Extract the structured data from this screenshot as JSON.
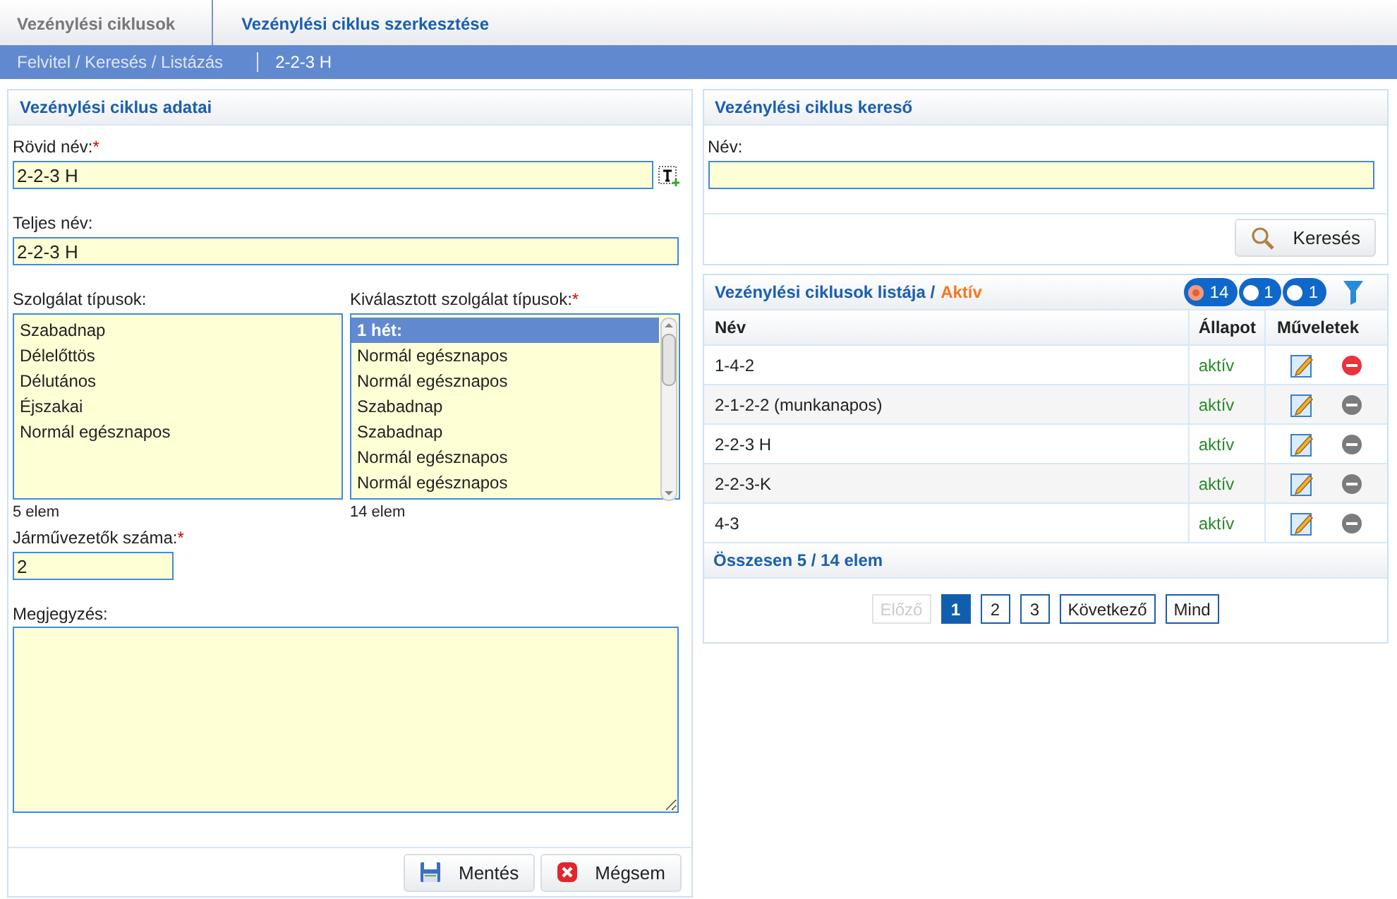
{
  "breadcrumb": {
    "items": [
      {
        "label": "Vezénylési ciklusok",
        "selected": false
      },
      {
        "label": "Vezénylési ciklus szerkesztése",
        "selected": true
      }
    ],
    "sub_items": [
      "Felvitel / Keresés / Listázás",
      "2-2-3 H"
    ]
  },
  "edit_panel": {
    "title": "Vezénylési ciklus adatai",
    "short_name": {
      "label": "Rövid név:",
      "required_mark": "*",
      "value": "2-2-3 H"
    },
    "full_name": {
      "label": "Teljes név:",
      "value": "2-2-3 H"
    },
    "service_types": {
      "label": "Szolgálat típusok:",
      "items": [
        {
          "label": "Szabadnap",
          "selected": false
        },
        {
          "label": "Délelőttös",
          "selected": false
        },
        {
          "label": "Délutános",
          "selected": false
        },
        {
          "label": "Éjszakai",
          "selected": false
        },
        {
          "label": "Normál egésznapos",
          "selected": false
        }
      ],
      "count": "5 elem"
    },
    "selected_types": {
      "label": "Kiválasztott szolgálat típusok:",
      "required_mark": "*",
      "items": [
        {
          "label": "1 hét:",
          "selected": true
        },
        {
          "label": "Normál egésznapos",
          "selected": false
        },
        {
          "label": "Normál egésznapos",
          "selected": false
        },
        {
          "label": "Szabadnap",
          "selected": false
        },
        {
          "label": "Szabadnap",
          "selected": false
        },
        {
          "label": "Normál egésznapos",
          "selected": false
        },
        {
          "label": "Normál egésznapos",
          "selected": false
        }
      ],
      "count": "14 elem"
    },
    "drivers": {
      "label": "Járművezetők száma:",
      "required_mark": "*",
      "value": "2"
    },
    "note": {
      "label": "Megjegyzés:"
    },
    "buttons": [
      {
        "kind": "save",
        "label": "Mentés"
      },
      {
        "kind": "cancel",
        "label": "Mégsem"
      }
    ]
  },
  "search_panel": {
    "title": "Vezénylési ciklus kereső",
    "name": {
      "label": "Név:"
    },
    "button": "Keresés"
  },
  "list_panel": {
    "title": "Vezénylési ciklusok listája /",
    "filter_label": "Aktív",
    "filters": [
      {
        "count": "14",
        "selected": true
      },
      {
        "count": "1",
        "selected": false
      },
      {
        "count": "1",
        "selected": false
      }
    ],
    "columns": [
      "Név",
      "Állapot",
      "Műveletek"
    ],
    "rows": [
      {
        "name": "1-4-2",
        "status": "aktív",
        "delete_enabled": true
      },
      {
        "name": "2-1-2-2 (munkanapos)",
        "status": "aktív",
        "delete_enabled": false
      },
      {
        "name": "2-2-3 H",
        "status": "aktív",
        "delete_enabled": false
      },
      {
        "name": "2-2-3-K",
        "status": "aktív",
        "delete_enabled": false
      },
      {
        "name": "4-3",
        "status": "aktív",
        "delete_enabled": false
      }
    ],
    "summary": "Összesen 5 / 14 elem",
    "pagination": [
      {
        "kind": "prev",
        "label": "Előző",
        "disabled": true,
        "selected": false
      },
      {
        "kind": "page",
        "label": "1",
        "disabled": false,
        "selected": true
      },
      {
        "kind": "page",
        "label": "2",
        "disabled": false,
        "selected": false
      },
      {
        "kind": "page",
        "label": "3",
        "disabled": false,
        "selected": false
      },
      {
        "kind": "next",
        "label": "Következő",
        "disabled": false,
        "selected": false
      },
      {
        "kind": "all",
        "label": "Mind",
        "disabled": false,
        "selected": false
      }
    ]
  }
}
